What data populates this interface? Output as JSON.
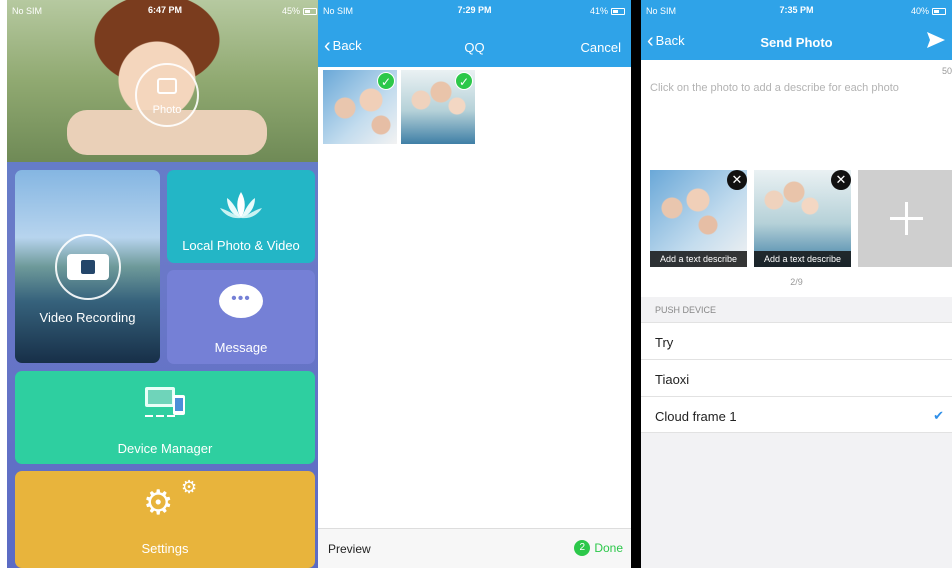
{
  "panel1": {
    "status": {
      "carrier": "No SIM",
      "time": "6:47 PM",
      "battery": "45%"
    },
    "hero_label": "Photo",
    "tiles": {
      "video": "Video Recording",
      "local": "Local Photo & Video",
      "message": "Message",
      "device": "Device Manager",
      "settings": "Settings"
    }
  },
  "panel2": {
    "status": {
      "carrier": "No SIM",
      "time": "7:29 PM",
      "battery": "41%"
    },
    "nav": {
      "back": "Back",
      "title": "QQ",
      "cancel": "Cancel"
    },
    "bottom": {
      "preview": "Preview",
      "count": "2",
      "done": "Done"
    }
  },
  "panel3": {
    "status": {
      "carrier": "No SIM",
      "time": "7:35 PM",
      "battery": "40%"
    },
    "nav": {
      "back": "Back",
      "title": "Send Photo"
    },
    "counter": "50",
    "hint": "Click on the photo to add a describe for each photo",
    "photos": [
      {
        "caption": "Add a text describe"
      },
      {
        "caption": "Add a text describe"
      }
    ],
    "page_indicator": "2/9",
    "section_title": "PUSH DEVICE",
    "devices": [
      {
        "name": "Try",
        "selected": false
      },
      {
        "name": "Tiaoxi",
        "selected": false
      },
      {
        "name": "Cloud frame 1",
        "selected": true
      }
    ],
    "check_glyph": "✔"
  },
  "colors": {
    "nav_blue": "#2fa3e8",
    "tile_local": "#23b6c6",
    "tile_message": "#7580d6",
    "tile_device": "#2ecfa0",
    "tile_settings": "#e8b43c",
    "check_green": "#2cc84a"
  }
}
